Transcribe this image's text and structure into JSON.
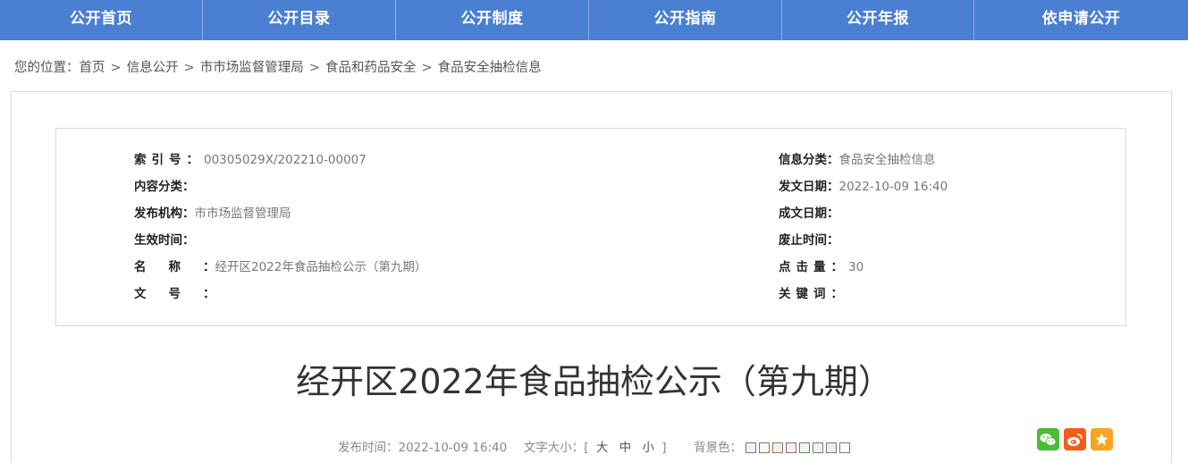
{
  "nav": {
    "items": [
      "公开首页",
      "公开目录",
      "公开制度",
      "公开指南",
      "公开年报",
      "依申请公开"
    ]
  },
  "breadcrumb": {
    "prefix": "您的位置：",
    "items": [
      "首页",
      "信息公开",
      "市市场监督管理局",
      "食品和药品安全",
      "食品安全抽检信息"
    ],
    "separator": ">"
  },
  "info": {
    "index_label": "索引号：",
    "index_value": "00305029X/202210-00007",
    "content_class_label": "内容分类：",
    "content_class_value": "",
    "publisher_label": "发布机构：",
    "publisher_value": "市市场监督管理局",
    "effective_label": "生效时间：",
    "effective_value": "",
    "name_label": "名称：",
    "name_value": "经开区2022年食品抽检公示（第九期）",
    "doc_no_label": "文号：",
    "doc_no_value": "",
    "info_class_label": "信息分类：",
    "info_class_value": "食品安全抽检信息",
    "issue_date_label": "发文日期：",
    "issue_date_value": "2022-10-09 16:40",
    "written_date_label": "成文日期：",
    "written_date_value": "",
    "expire_label": "废止时间：",
    "expire_value": "",
    "clicks_label": "点击量：",
    "clicks_value": "30",
    "keywords_label": "关键词：",
    "keywords_value": ""
  },
  "article": {
    "title": "经开区2022年食品抽检公示（第九期）",
    "publish_time_label": "发布时间：",
    "publish_time": "2022-10-09 16:40",
    "font_size_label": "文字大小：[",
    "font_size_large": "大",
    "font_size_medium": "中",
    "font_size_small": "小",
    "font_size_close": "]",
    "background_label": "背景色：",
    "background_colors": [
      "#f3f3f3",
      "#fffbe8",
      "#fbf0e4",
      "#fdeced",
      "#eef8e8",
      "#e9f6f8",
      "#eeeeee",
      "#ffffff"
    ]
  },
  "share": {
    "icons": [
      "wechat-icon",
      "weibo-icon",
      "favorite-icon"
    ],
    "colors": {
      "wechat": "#4cbb35",
      "weibo": "#f45c1c",
      "favorite": "#f5a623"
    }
  },
  "colors": {
    "nav_bg": "#4a7fd1"
  }
}
